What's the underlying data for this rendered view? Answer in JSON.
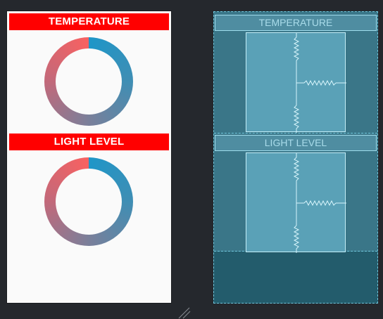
{
  "design_preview": {
    "sections": [
      {
        "header": "TEMPERATURE"
      },
      {
        "header": "LIGHT LEVEL"
      }
    ]
  },
  "blueprint": {
    "sections": [
      {
        "header": "TEMPERATURE"
      },
      {
        "header": "LIGHT LEVEL"
      }
    ]
  },
  "colors": {
    "header_background": "#ff0000",
    "header_text": "#ffffff",
    "ring_start": "#1e96c8",
    "ring_end": "#f96161",
    "canvas_background": "#25282d",
    "blueprint_background": "#235c6c"
  }
}
